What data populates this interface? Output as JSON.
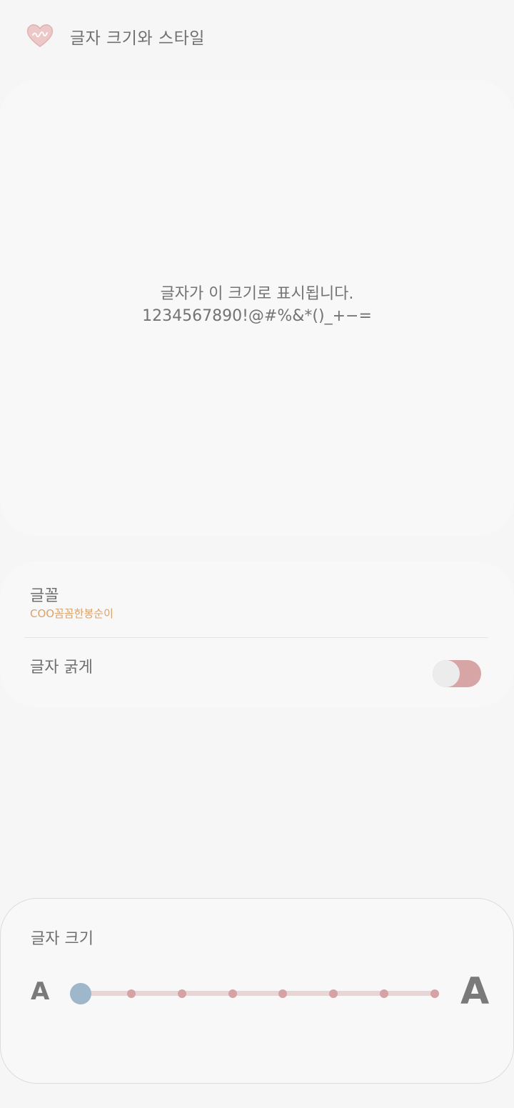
{
  "header": {
    "back_icon": "heart-back-icon",
    "title": "글자 크기와 스타일"
  },
  "preview": {
    "line1": "글자가 이 크기로 표시됩니다.",
    "line2": "1234567890!@#%&*()_+−="
  },
  "settings": {
    "font": {
      "label": "글꼴",
      "value": "COO꼼꼼한봉순이"
    },
    "bold": {
      "label": "글자 굵게",
      "enabled": false
    }
  },
  "font_size": {
    "label": "글자 크기",
    "small_glyph": "A",
    "large_glyph": "A",
    "steps": 8,
    "selected_step": 0
  },
  "colors": {
    "accent_pink": "#d8a5a6",
    "thumb_blue": "#9fb7cb",
    "font_value": "#d9a26c"
  }
}
